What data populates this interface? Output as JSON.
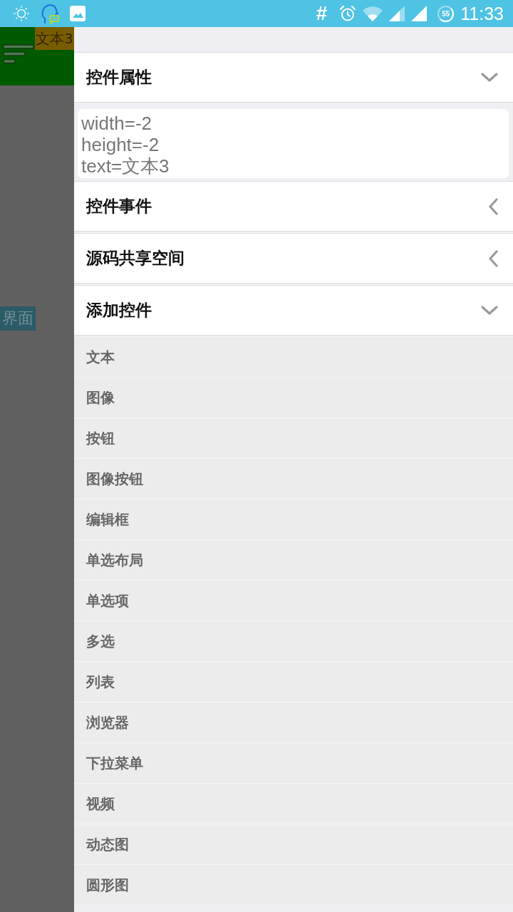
{
  "status_bar": {
    "hash": "#",
    "battery": "55",
    "time": "11:33"
  },
  "preview": {
    "label": "文本3",
    "screen_label": "界面"
  },
  "drawer": {
    "sections": [
      {
        "title": "控件属性",
        "expanded": true,
        "properties": [
          "width=-2",
          "height=-2",
          "text=文本3"
        ]
      },
      {
        "title": "控件事件",
        "expanded": false
      },
      {
        "title": "源码共享空间",
        "expanded": false
      },
      {
        "title": "添加控件",
        "expanded": true,
        "items": [
          "文本",
          "图像",
          "按钮",
          "图像按钮",
          "编辑框",
          "单选布局",
          "单选项",
          "多选",
          "列表",
          "浏览器",
          "下拉菜单",
          "视频",
          "动态图",
          "圆形图"
        ]
      }
    ]
  }
}
